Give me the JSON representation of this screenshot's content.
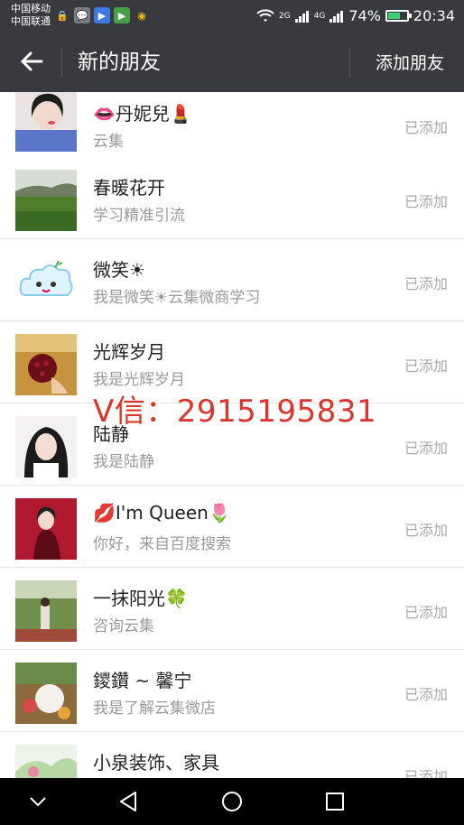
{
  "status_bar": {
    "carrier_1": "中国移动",
    "carrier_2": "中国联通",
    "net_1": "2G",
    "net_2": "4G",
    "battery": "74%",
    "battery_level": 0.74,
    "time": "20:34"
  },
  "header": {
    "title": "新的朋友",
    "action": "添加朋友"
  },
  "contacts": [
    {
      "name": "👄丹妮兒💄",
      "message": "云集",
      "status": "已添加"
    },
    {
      "name": "春暖花开",
      "message": "学习精准引流",
      "status": "已添加"
    },
    {
      "name": "微笑☀",
      "message": "我是微笑☀云集微商学习",
      "status": "已添加"
    },
    {
      "name": "光辉岁月",
      "message": "我是光辉岁月",
      "status": "已添加"
    },
    {
      "name": "陆静",
      "message": "我是陆静",
      "status": "已添加"
    },
    {
      "name": "💋I'm Queen🌷",
      "message": "你好，来自百度搜索",
      "status": "已添加"
    },
    {
      "name": "一抹阳光🍀",
      "message": "咨询云集",
      "status": "已添加"
    },
    {
      "name": "鑁鑽 ~ 馨宁",
      "message": "我是了解云集微店",
      "status": "已添加"
    },
    {
      "name": "小泉装饰、家具",
      "message": "",
      "status": "已添加"
    }
  ],
  "watermark": "V信：2915195831",
  "colors": {
    "bar": "#393a3f",
    "watermark": "#d9352a"
  }
}
